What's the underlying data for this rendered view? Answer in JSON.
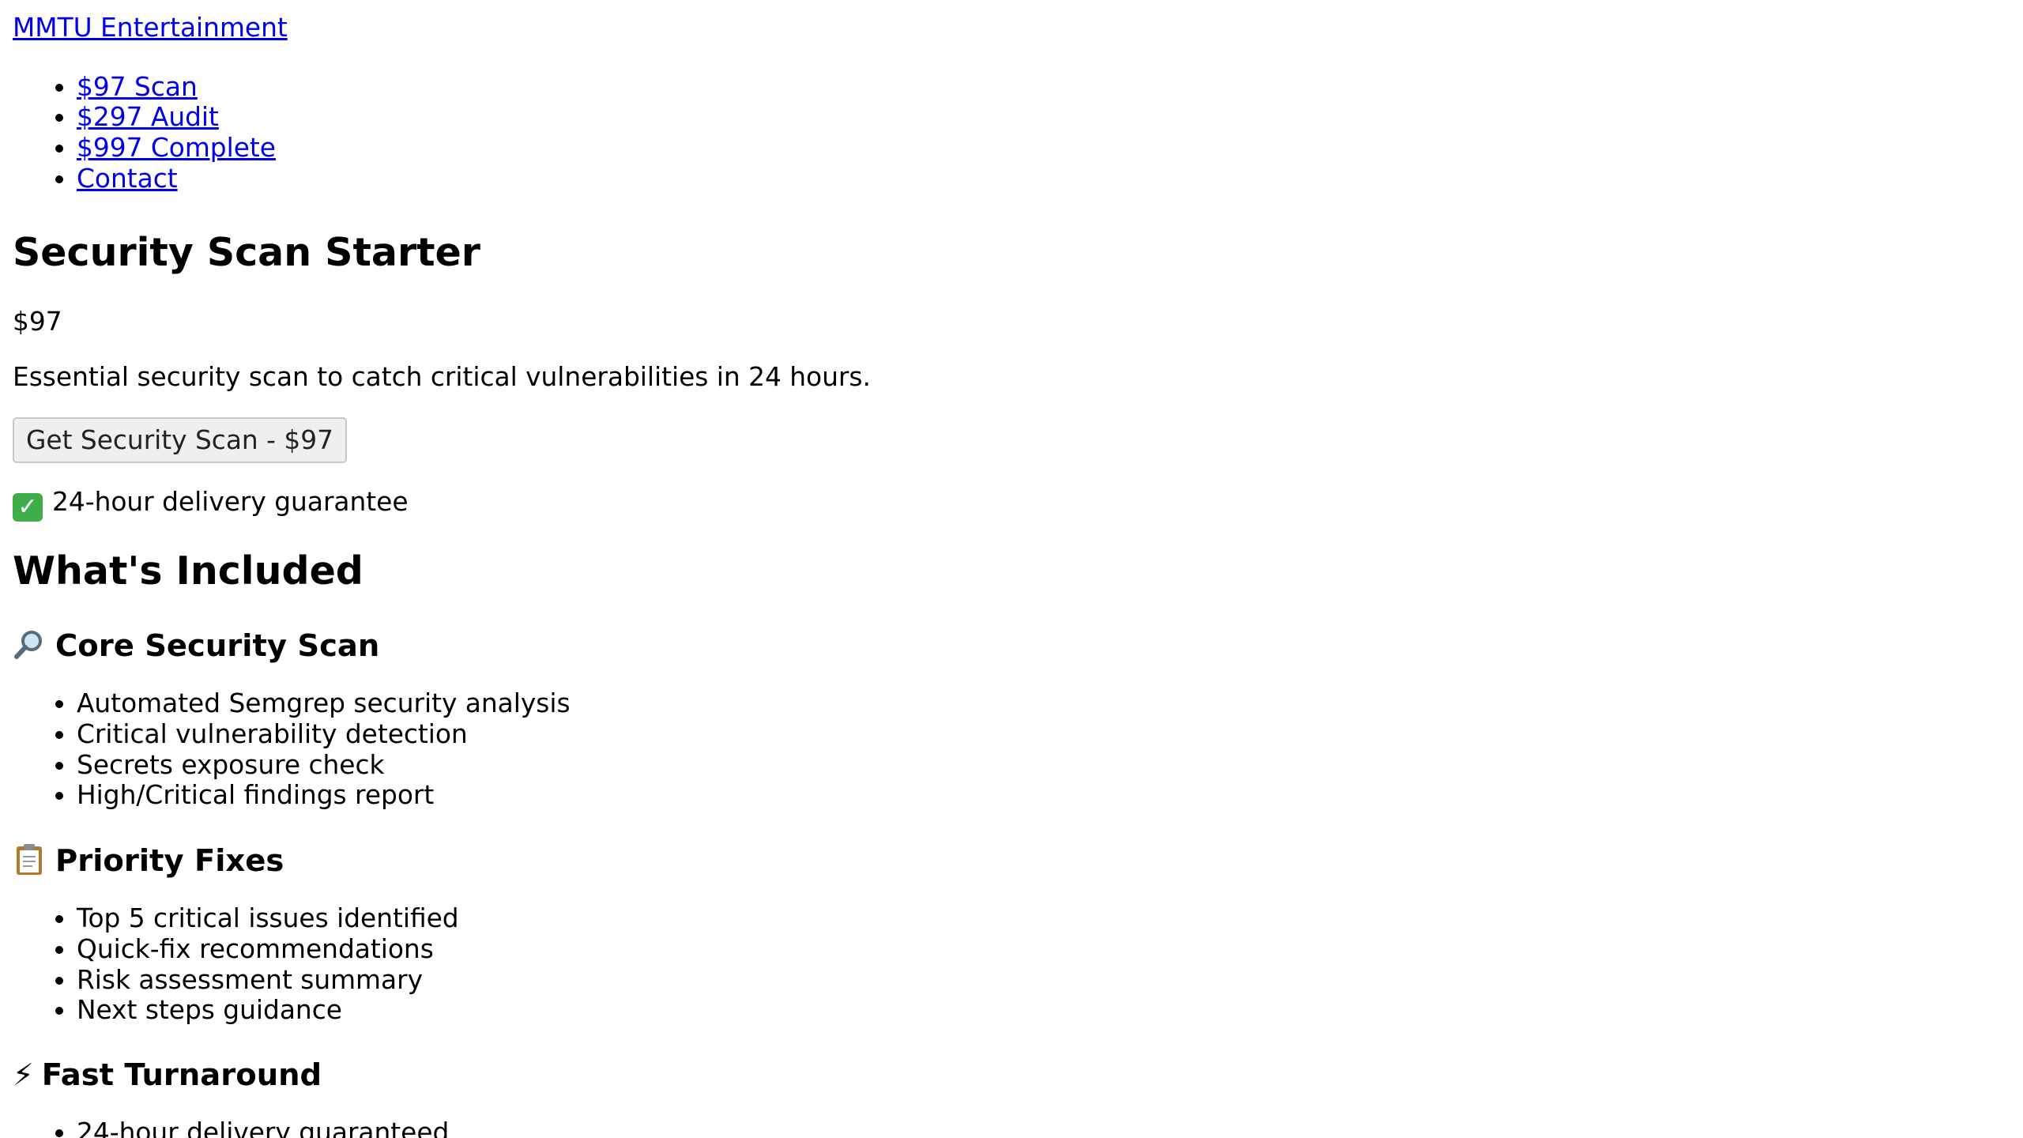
{
  "header": {
    "brand": "MMTU Entertainment"
  },
  "nav": {
    "items": [
      {
        "label": "$97 Scan"
      },
      {
        "label": "$297 Audit"
      },
      {
        "label": "$997 Complete"
      },
      {
        "label": "Contact"
      }
    ]
  },
  "product": {
    "title": "Security Scan Starter",
    "price": "$97",
    "description": "Essential security scan to catch critical vulnerabilities in 24 hours.",
    "cta_label": "Get Security Scan - $97",
    "guarantee": "24-hour delivery guarantee",
    "guarantee_icon": "check-mark-icon"
  },
  "included": {
    "heading": "What's Included",
    "sections": [
      {
        "icon": "magnifying-glass-icon",
        "title": "Core Security Scan",
        "items": [
          "Automated Semgrep security analysis",
          "Critical vulnerability detection",
          "Secrets exposure check",
          "High/Critical findings report"
        ]
      },
      {
        "icon": "clipboard-icon",
        "title": "Priority Fixes",
        "items": [
          "Top 5 critical issues identified",
          "Quick-fix recommendations",
          "Risk assessment summary",
          "Next steps guidance"
        ]
      },
      {
        "icon": "lightning-icon",
        "title": "Fast Turnaround",
        "items": [
          "24-hour delivery guaranteed"
        ]
      }
    ]
  }
}
